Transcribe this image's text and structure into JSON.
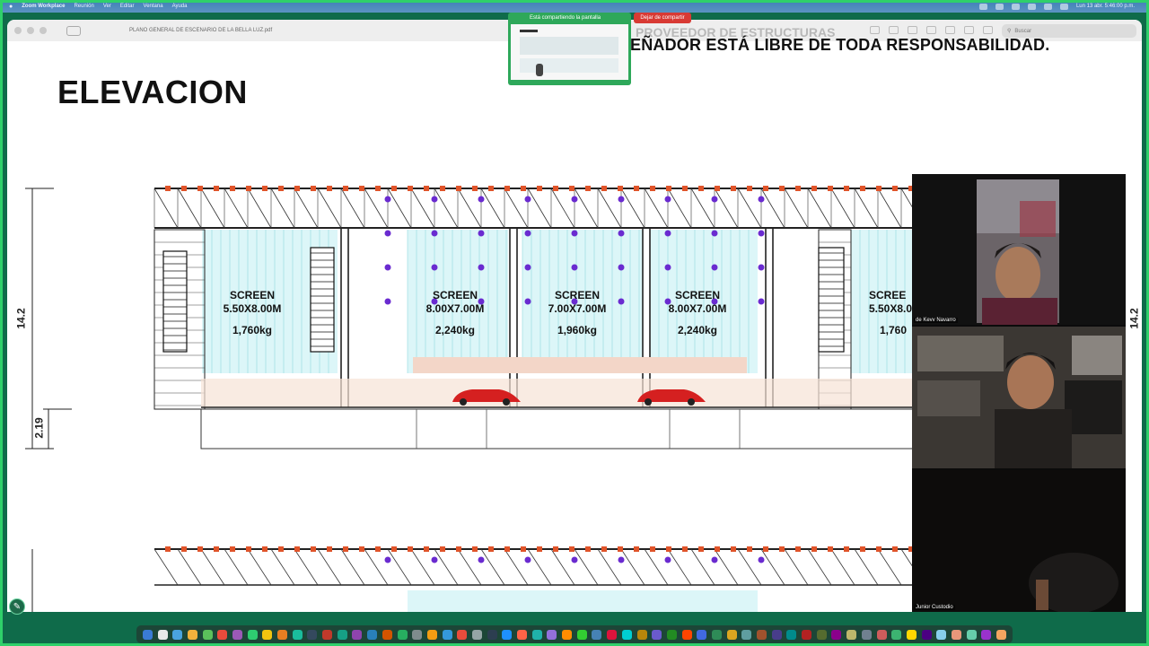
{
  "menubar": {
    "app_name": "Zoom Workplace",
    "items": [
      "Reunión",
      "Ver",
      "Editar",
      "Ventana",
      "Ayuda"
    ],
    "clock": "Lun 13 abr.  5:46:00 p.m."
  },
  "viewer": {
    "document_title": "PLANO GENERAL DE ESCENARIO DE LA BELLA LUZ.pdf",
    "search_placeholder": "Buscar"
  },
  "slide": {
    "disclaimer": "EÑADOR ESTÁ LIBRE DE TODA RESPONSABILIDAD.",
    "disclaimer_partial": "PROVEEDOR DE ESTRUCTURAS",
    "title": "ELEVACION",
    "dim_height": "14.2",
    "dim_height_right": "14.2",
    "dim_lower": "2.19",
    "screens": [
      {
        "label": "SCREEN",
        "size": "5.50X8.00M",
        "weight": "1,760kg"
      },
      {
        "label": "SCREEN",
        "size": "8.00X7.00M",
        "weight": "2,240kg"
      },
      {
        "label": "SCREEN",
        "size": "7.00X7.00M",
        "weight": "1,960kg"
      },
      {
        "label": "SCREEN",
        "size": "8.00X7.00M",
        "weight": "2,240kg"
      },
      {
        "label": "SCREE",
        "size": "5.50X8.0",
        "weight": "1,760"
      }
    ]
  },
  "zoom": {
    "sharing_status": "Está compartiendo la pantalla",
    "stop_share": "Dejar de compartir",
    "participants": [
      {
        "name": "de Kevv Navarro"
      },
      {
        "name": ""
      },
      {
        "name": "Junior Custodio"
      }
    ]
  },
  "colors": {
    "share_green": "#2fd06a",
    "truss_red": "#e0542a",
    "light_purple": "#6a2bd0",
    "screen_cyan": "#bfeff3",
    "stop_red": "#d83a34"
  }
}
